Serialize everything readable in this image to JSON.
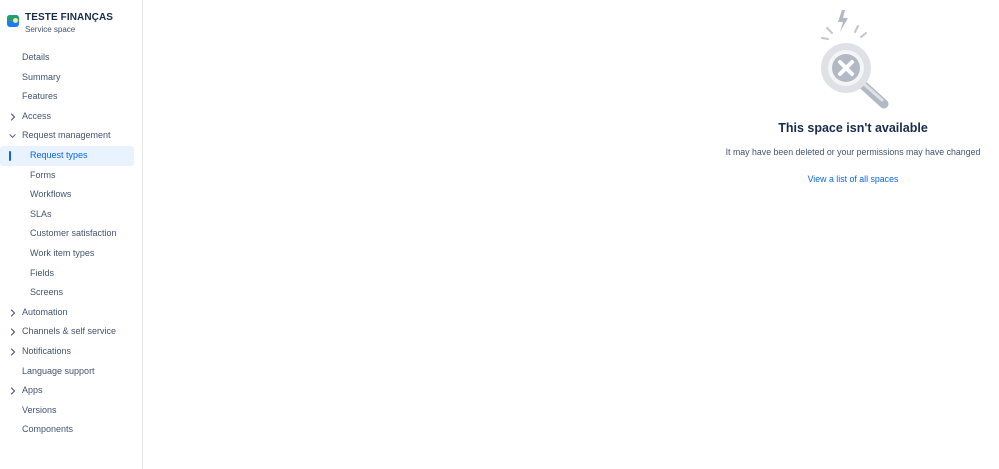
{
  "project": {
    "name": "TESTE FINANÇAS",
    "type": "Service space",
    "icon": "project-avatar-icon"
  },
  "sidebar": {
    "items": [
      {
        "label": "Details",
        "chevron": "none",
        "level": 0
      },
      {
        "label": "Summary",
        "chevron": "none",
        "level": 0
      },
      {
        "label": "Features",
        "chevron": "none",
        "level": 0
      },
      {
        "label": "Access",
        "chevron": "right",
        "level": 0
      },
      {
        "label": "Request management",
        "chevron": "down",
        "level": 0
      },
      {
        "label": "Request types",
        "chevron": "none",
        "level": 1,
        "active": true
      },
      {
        "label": "Forms",
        "chevron": "none",
        "level": 1
      },
      {
        "label": "Workflows",
        "chevron": "none",
        "level": 1
      },
      {
        "label": "SLAs",
        "chevron": "none",
        "level": 1
      },
      {
        "label": "Customer satisfaction",
        "chevron": "none",
        "level": 1
      },
      {
        "label": "Work item types",
        "chevron": "none",
        "level": 1
      },
      {
        "label": "Fields",
        "chevron": "none",
        "level": 1
      },
      {
        "label": "Screens",
        "chevron": "none",
        "level": 1
      },
      {
        "label": "Automation",
        "chevron": "right",
        "level": 0
      },
      {
        "label": "Channels & self service",
        "chevron": "right",
        "level": 0
      },
      {
        "label": "Notifications",
        "chevron": "right",
        "level": 0
      },
      {
        "label": "Language support",
        "chevron": "none",
        "level": 0
      },
      {
        "label": "Apps",
        "chevron": "right",
        "level": 0
      },
      {
        "label": "Versions",
        "chevron": "none",
        "level": 0
      },
      {
        "label": "Components",
        "chevron": "none",
        "level": 0
      }
    ]
  },
  "main": {
    "illustration": "magnifier-error-icon",
    "title": "This space isn't available",
    "message": "It may have been deleted or your permissions may have changed",
    "link": "View a list of all spaces"
  },
  "colors": {
    "accent": "#0c66e4",
    "active_bg": "#e9f2ff",
    "text": "#172b4d",
    "subtle_text": "#44546f"
  }
}
